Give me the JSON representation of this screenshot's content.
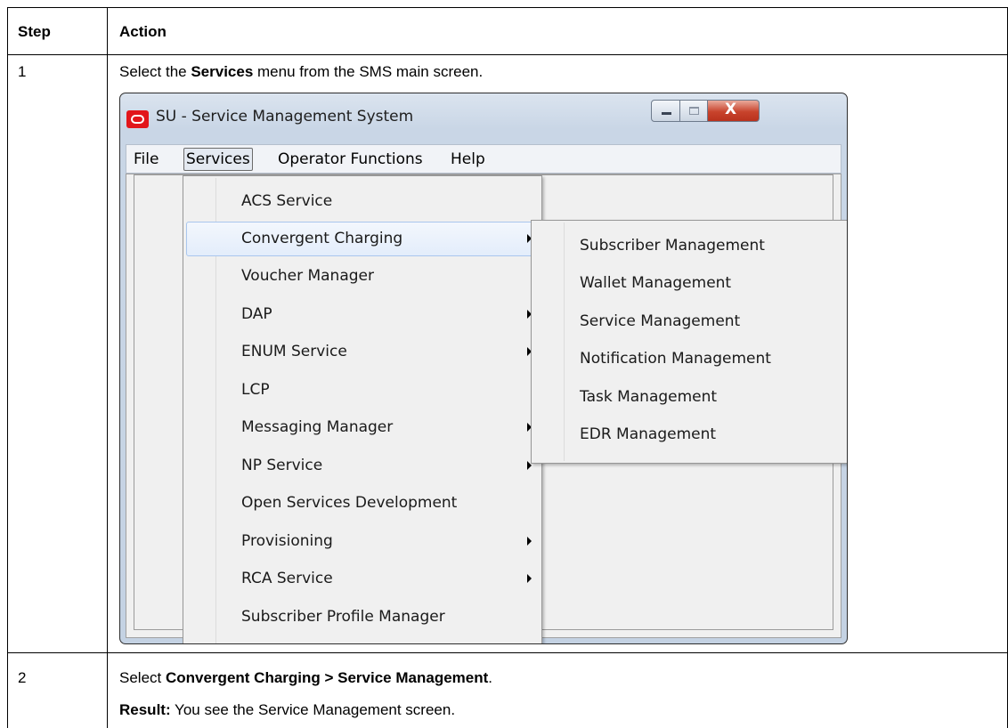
{
  "table": {
    "headers": {
      "step": "Step",
      "action": "Action"
    },
    "rows": [
      {
        "step": "1",
        "text_before": "Select the ",
        "text_bold": "Services",
        "text_after": " menu from the SMS main screen."
      },
      {
        "step": "2",
        "line1_before": "Select ",
        "line1_bold": "Convergent Charging > Service Management",
        "line1_after": ".",
        "line2_bold": "Result:",
        "line2_after": " You see the Service Management screen."
      }
    ]
  },
  "window": {
    "title": "SU - Service Management System",
    "menubar": [
      "File",
      "Services",
      "Operator Functions",
      "Help"
    ],
    "services_menu": [
      {
        "label": "ACS Service",
        "submenu": false
      },
      {
        "label": "Convergent Charging",
        "submenu": true,
        "highlighted": true
      },
      {
        "label": "Voucher Manager",
        "submenu": false
      },
      {
        "label": "DAP",
        "submenu": true
      },
      {
        "label": "ENUM Service",
        "submenu": true
      },
      {
        "label": "LCP",
        "submenu": false
      },
      {
        "label": "Messaging Manager",
        "submenu": true
      },
      {
        "label": "NP Service",
        "submenu": true
      },
      {
        "label": "Open Services Development",
        "submenu": false
      },
      {
        "label": "Provisioning",
        "submenu": true
      },
      {
        "label": "RCA Service",
        "submenu": true
      },
      {
        "label": "Subscriber Profile Manager",
        "submenu": false
      }
    ],
    "convergent_charging_submenu": [
      "Subscriber Management",
      "Wallet Management",
      "Service Management",
      "Notification Management",
      "Task Management",
      "EDR Management"
    ],
    "controls": {
      "close_glyph": "X"
    },
    "colors": {
      "logo": "#e2161b",
      "close_button": "#c8432c",
      "highlight_border": "#a9c6ee"
    }
  }
}
